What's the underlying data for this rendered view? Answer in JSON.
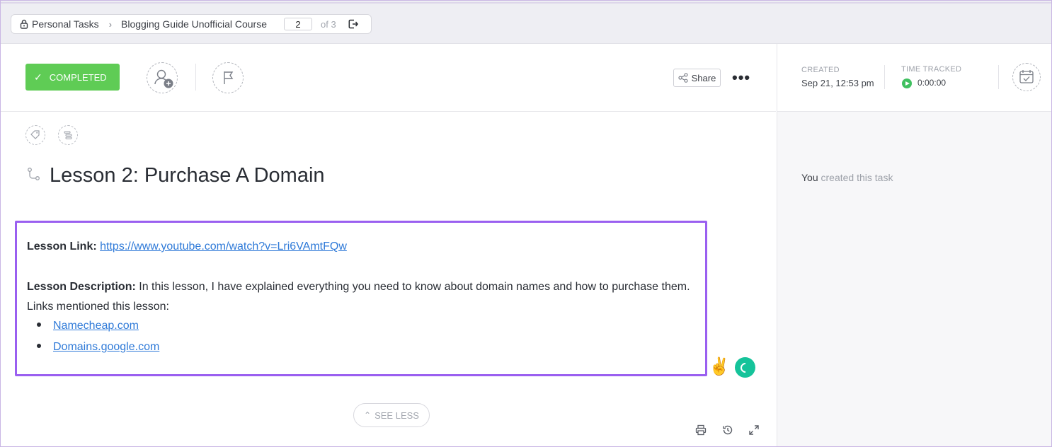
{
  "breadcrumb": {
    "space": "Personal Tasks",
    "list": "Blogging Guide Unofficial Course",
    "page_current": "2",
    "page_total": "of 3"
  },
  "task": {
    "status_label": "COMPLETED",
    "share_label": "Share",
    "more_label": "•••",
    "title": "Lesson 2: Purchase A Domain"
  },
  "meta": {
    "created_label": "CREATED",
    "created_value": "Sep 21, 12:53 pm",
    "time_label": "TIME TRACKED",
    "time_value": "0:00:00"
  },
  "description": {
    "link_label": "Lesson Link:",
    "link_url": "https://www.youtube.com/watch?v=Lri6VAmtFQw",
    "desc_label": "Lesson Description:",
    "desc_text": " In this lesson, I have explained everything you need to know about domain names and how to purchase them.",
    "links_intro": "Links mentioned this lesson:",
    "links": [
      "Namecheap.com",
      "Domains.google.com"
    ]
  },
  "see_less_label": "SEE LESS",
  "activity": {
    "actor": "You",
    "text": " created this task"
  },
  "colors": {
    "completed": "#5fcc55",
    "highlight_border": "#9a5ff0",
    "link": "#2f7ad8",
    "timer": "#3fc05f"
  },
  "icons": [
    "lock-icon",
    "chevron-right-icon",
    "exit-icon",
    "check-icon",
    "add-assignee-icon",
    "flag-icon",
    "share-icon",
    "more-icon",
    "play-icon",
    "calendar-icon",
    "tag-icon",
    "subtasks-icon",
    "subtask-icon",
    "peace-emoji-icon",
    "grammarly-icon",
    "chevron-up-icon",
    "print-icon",
    "history-icon",
    "expand-icon"
  ]
}
